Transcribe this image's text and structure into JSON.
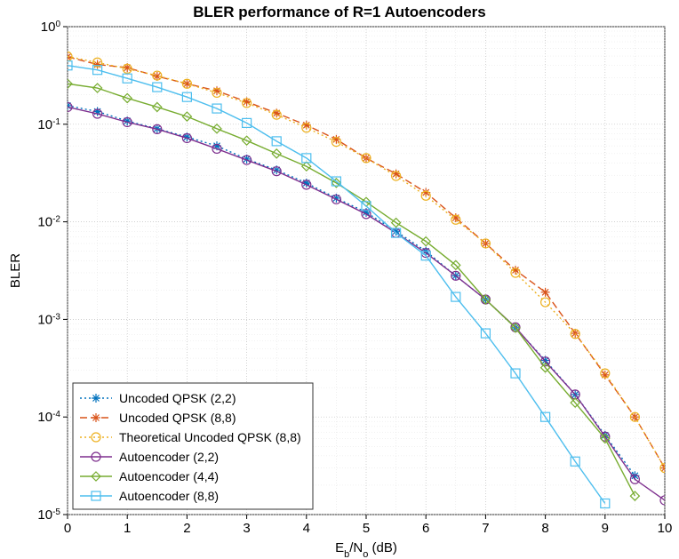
{
  "chart_data": {
    "type": "line",
    "title": "BLER performance of R=1 Autoencoders",
    "xlabel_html": "E<tspan baseline-shift=\"sub\" font-size=\"11\">b</tspan>/N<tspan baseline-shift=\"sub\" font-size=\"11\">o</tspan> (dB)",
    "ylabel": "BLER",
    "xlim": [
      0,
      10
    ],
    "ylim": [
      1e-05,
      1
    ],
    "x": [
      0,
      0.5,
      1,
      1.5,
      2,
      2.5,
      3,
      3.5,
      4,
      4.5,
      5,
      5.5,
      6,
      6.5,
      7,
      7.5,
      8,
      8.5,
      9,
      9.5,
      10
    ],
    "series": [
      {
        "name": "Uncoded QPSK (2,2)",
        "color": "#0072BD",
        "dash": "2,3",
        "marker": "asterisk",
        "values": [
          0.155,
          0.135,
          0.108,
          0.09,
          0.074,
          0.06,
          0.044,
          0.034,
          0.025,
          0.0175,
          0.0125,
          0.008,
          0.005,
          0.0028,
          0.0016,
          0.00082,
          0.00038,
          0.00017,
          6.5e-05,
          2.5e-05,
          null
        ]
      },
      {
        "name": "Uncoded QPSK (8,8)",
        "color": "#D95319",
        "dash": "8,4",
        "marker": "asterisk",
        "values": [
          0.49,
          0.41,
          0.38,
          0.31,
          0.26,
          0.22,
          0.17,
          0.13,
          0.098,
          0.07,
          0.045,
          0.031,
          0.02,
          0.011,
          0.006,
          0.0032,
          0.0019,
          0.00072,
          0.00027,
          0.0001,
          3e-05
        ]
      },
      {
        "name": "Theoretical Uncoded QPSK (8,8)",
        "color": "#EDB120",
        "dash": "2,3",
        "marker": "circle",
        "values": [
          0.495,
          0.43,
          0.37,
          0.315,
          0.26,
          0.21,
          0.165,
          0.125,
          0.092,
          0.066,
          0.045,
          0.0295,
          0.0185,
          0.0105,
          0.006,
          0.003,
          0.0015,
          0.00071,
          0.00028,
          0.0001,
          3e-05
        ]
      },
      {
        "name": "Autoencoder (2,2)",
        "color": "#7E2F8E",
        "dash": null,
        "marker": "circle",
        "values": [
          0.15,
          0.128,
          0.105,
          0.089,
          0.072,
          0.056,
          0.043,
          0.033,
          0.024,
          0.017,
          0.012,
          0.0077,
          0.0048,
          0.0028,
          0.0016,
          0.00083,
          0.00037,
          0.00017,
          6.3e-05,
          2.3e-05,
          1.4e-05
        ]
      },
      {
        "name": "Autoencoder (4,4)",
        "color": "#77AC30",
        "dash": null,
        "marker": "diamond",
        "values": [
          0.26,
          0.235,
          0.185,
          0.15,
          0.12,
          0.09,
          0.068,
          0.05,
          0.037,
          0.025,
          0.016,
          0.0098,
          0.0063,
          0.0036,
          0.0016,
          0.00082,
          0.00032,
          0.00014,
          6e-05,
          1.55e-05,
          null
        ]
      },
      {
        "name": "Autoencoder (8,8)",
        "color": "#4DBEEE",
        "dash": null,
        "marker": "square",
        "values": [
          0.4,
          0.36,
          0.295,
          0.24,
          0.19,
          0.145,
          0.103,
          0.067,
          0.045,
          0.026,
          0.0145,
          0.0077,
          0.0045,
          0.0017,
          0.00072,
          0.00028,
          0.0001,
          3.5e-05,
          1.3e-05,
          null,
          null
        ]
      }
    ],
    "legend_pos": "lower-left"
  }
}
